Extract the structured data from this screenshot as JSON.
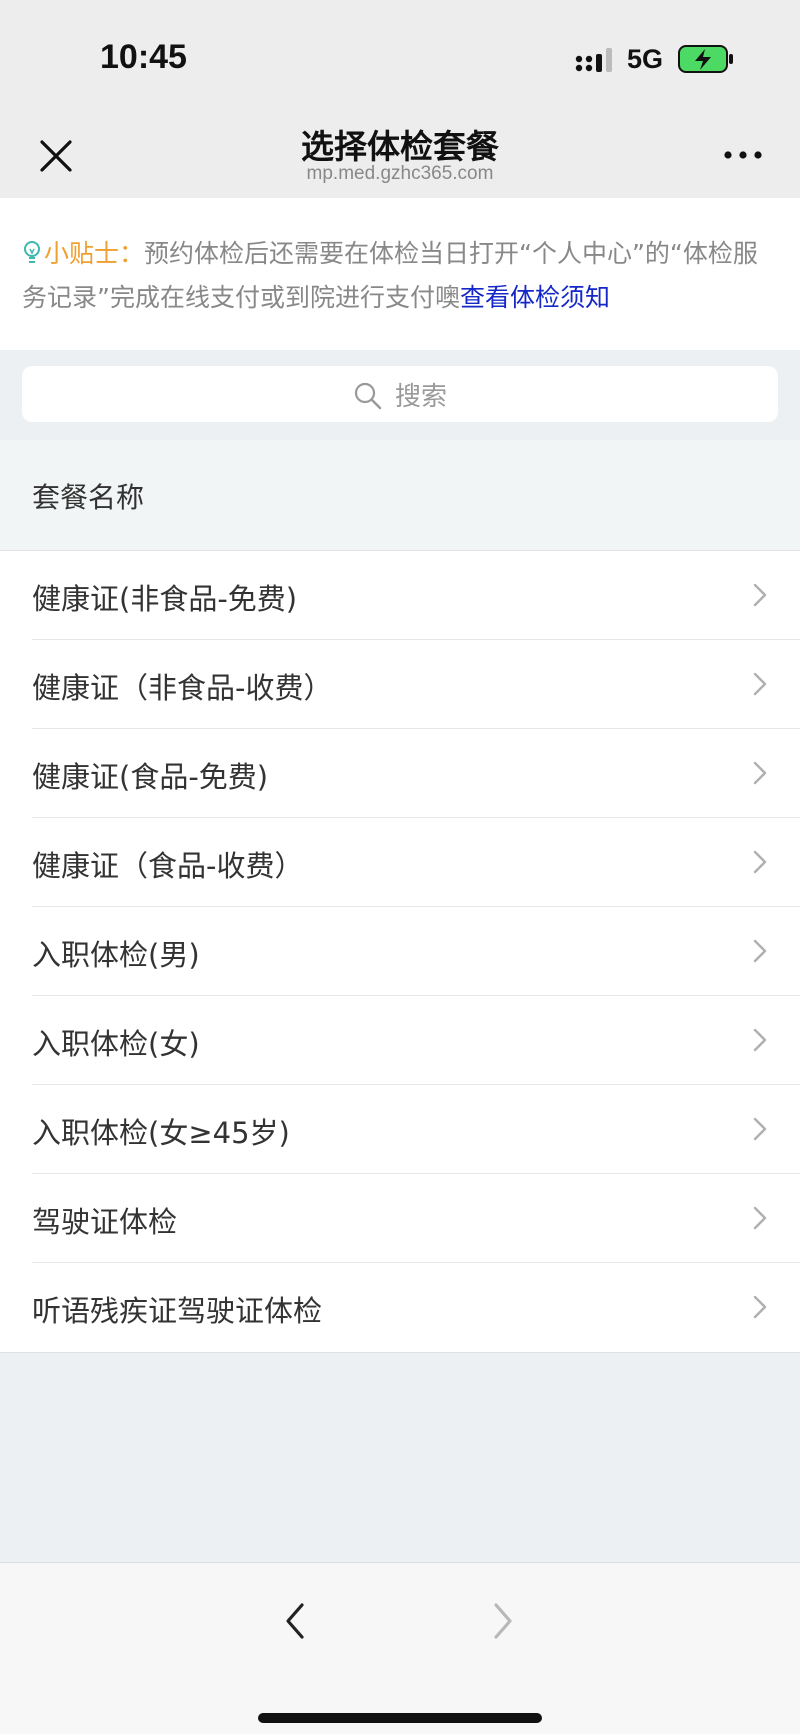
{
  "status_bar": {
    "time": "10:45",
    "network": "5G",
    "battery_icon": "battery-charging-icon",
    "signal_icon": "signal-bars-icon"
  },
  "nav": {
    "title": "选择体检套餐",
    "url": "mp.med.gzhc365.com",
    "close_icon": "close-icon",
    "more_icon": "more-dots-icon"
  },
  "tip": {
    "icon": "lightbulb-icon",
    "label": "小贴士：",
    "text": "预约体检后还需要在体检当日打开“个人中心”的“体检服务记录”完成在线支付或到院进行支付噢",
    "link": "查看体检须知",
    "colors": {
      "label": "#f0a030",
      "link": "#1428c8",
      "icon": "#3cb8b0"
    }
  },
  "search": {
    "placeholder": "搜索",
    "icon": "search-icon"
  },
  "section": {
    "title": "套餐名称"
  },
  "packages": [
    "健康证(非食品-免费)",
    "健康证（非食品-收费）",
    "健康证(食品-免费)",
    "健康证（食品-收费）",
    "入职体检(男)",
    "入职体检(女)",
    "入职体检(女≥45岁)",
    "驾驶证体检",
    "听语残疾证驾驶证体检"
  ],
  "bottom_nav": {
    "back_icon": "chevron-left-icon",
    "forward_icon": "chevron-right-icon"
  }
}
